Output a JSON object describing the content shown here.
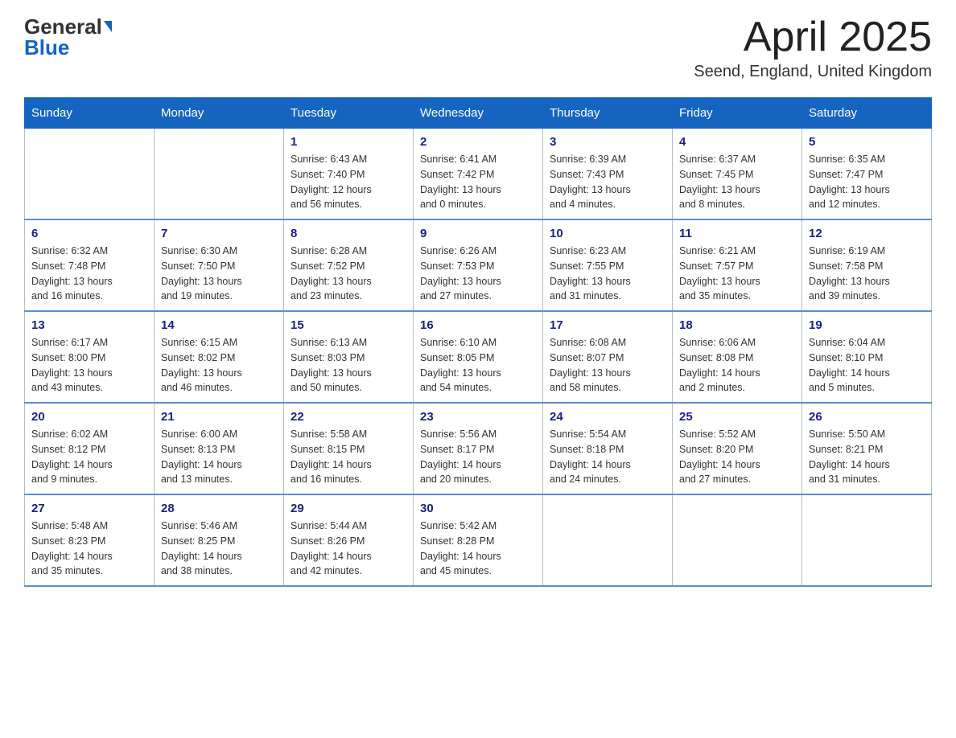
{
  "header": {
    "logo_general": "General",
    "logo_blue": "Blue",
    "title": "April 2025",
    "subtitle": "Seend, England, United Kingdom"
  },
  "days_of_week": [
    "Sunday",
    "Monday",
    "Tuesday",
    "Wednesday",
    "Thursday",
    "Friday",
    "Saturday"
  ],
  "weeks": [
    [
      {
        "day": "",
        "info": ""
      },
      {
        "day": "",
        "info": ""
      },
      {
        "day": "1",
        "info": "Sunrise: 6:43 AM\nSunset: 7:40 PM\nDaylight: 12 hours\nand 56 minutes."
      },
      {
        "day": "2",
        "info": "Sunrise: 6:41 AM\nSunset: 7:42 PM\nDaylight: 13 hours\nand 0 minutes."
      },
      {
        "day": "3",
        "info": "Sunrise: 6:39 AM\nSunset: 7:43 PM\nDaylight: 13 hours\nand 4 minutes."
      },
      {
        "day": "4",
        "info": "Sunrise: 6:37 AM\nSunset: 7:45 PM\nDaylight: 13 hours\nand 8 minutes."
      },
      {
        "day": "5",
        "info": "Sunrise: 6:35 AM\nSunset: 7:47 PM\nDaylight: 13 hours\nand 12 minutes."
      }
    ],
    [
      {
        "day": "6",
        "info": "Sunrise: 6:32 AM\nSunset: 7:48 PM\nDaylight: 13 hours\nand 16 minutes."
      },
      {
        "day": "7",
        "info": "Sunrise: 6:30 AM\nSunset: 7:50 PM\nDaylight: 13 hours\nand 19 minutes."
      },
      {
        "day": "8",
        "info": "Sunrise: 6:28 AM\nSunset: 7:52 PM\nDaylight: 13 hours\nand 23 minutes."
      },
      {
        "day": "9",
        "info": "Sunrise: 6:26 AM\nSunset: 7:53 PM\nDaylight: 13 hours\nand 27 minutes."
      },
      {
        "day": "10",
        "info": "Sunrise: 6:23 AM\nSunset: 7:55 PM\nDaylight: 13 hours\nand 31 minutes."
      },
      {
        "day": "11",
        "info": "Sunrise: 6:21 AM\nSunset: 7:57 PM\nDaylight: 13 hours\nand 35 minutes."
      },
      {
        "day": "12",
        "info": "Sunrise: 6:19 AM\nSunset: 7:58 PM\nDaylight: 13 hours\nand 39 minutes."
      }
    ],
    [
      {
        "day": "13",
        "info": "Sunrise: 6:17 AM\nSunset: 8:00 PM\nDaylight: 13 hours\nand 43 minutes."
      },
      {
        "day": "14",
        "info": "Sunrise: 6:15 AM\nSunset: 8:02 PM\nDaylight: 13 hours\nand 46 minutes."
      },
      {
        "day": "15",
        "info": "Sunrise: 6:13 AM\nSunset: 8:03 PM\nDaylight: 13 hours\nand 50 minutes."
      },
      {
        "day": "16",
        "info": "Sunrise: 6:10 AM\nSunset: 8:05 PM\nDaylight: 13 hours\nand 54 minutes."
      },
      {
        "day": "17",
        "info": "Sunrise: 6:08 AM\nSunset: 8:07 PM\nDaylight: 13 hours\nand 58 minutes."
      },
      {
        "day": "18",
        "info": "Sunrise: 6:06 AM\nSunset: 8:08 PM\nDaylight: 14 hours\nand 2 minutes."
      },
      {
        "day": "19",
        "info": "Sunrise: 6:04 AM\nSunset: 8:10 PM\nDaylight: 14 hours\nand 5 minutes."
      }
    ],
    [
      {
        "day": "20",
        "info": "Sunrise: 6:02 AM\nSunset: 8:12 PM\nDaylight: 14 hours\nand 9 minutes."
      },
      {
        "day": "21",
        "info": "Sunrise: 6:00 AM\nSunset: 8:13 PM\nDaylight: 14 hours\nand 13 minutes."
      },
      {
        "day": "22",
        "info": "Sunrise: 5:58 AM\nSunset: 8:15 PM\nDaylight: 14 hours\nand 16 minutes."
      },
      {
        "day": "23",
        "info": "Sunrise: 5:56 AM\nSunset: 8:17 PM\nDaylight: 14 hours\nand 20 minutes."
      },
      {
        "day": "24",
        "info": "Sunrise: 5:54 AM\nSunset: 8:18 PM\nDaylight: 14 hours\nand 24 minutes."
      },
      {
        "day": "25",
        "info": "Sunrise: 5:52 AM\nSunset: 8:20 PM\nDaylight: 14 hours\nand 27 minutes."
      },
      {
        "day": "26",
        "info": "Sunrise: 5:50 AM\nSunset: 8:21 PM\nDaylight: 14 hours\nand 31 minutes."
      }
    ],
    [
      {
        "day": "27",
        "info": "Sunrise: 5:48 AM\nSunset: 8:23 PM\nDaylight: 14 hours\nand 35 minutes."
      },
      {
        "day": "28",
        "info": "Sunrise: 5:46 AM\nSunset: 8:25 PM\nDaylight: 14 hours\nand 38 minutes."
      },
      {
        "day": "29",
        "info": "Sunrise: 5:44 AM\nSunset: 8:26 PM\nDaylight: 14 hours\nand 42 minutes."
      },
      {
        "day": "30",
        "info": "Sunrise: 5:42 AM\nSunset: 8:28 PM\nDaylight: 14 hours\nand 45 minutes."
      },
      {
        "day": "",
        "info": ""
      },
      {
        "day": "",
        "info": ""
      },
      {
        "day": "",
        "info": ""
      }
    ]
  ]
}
